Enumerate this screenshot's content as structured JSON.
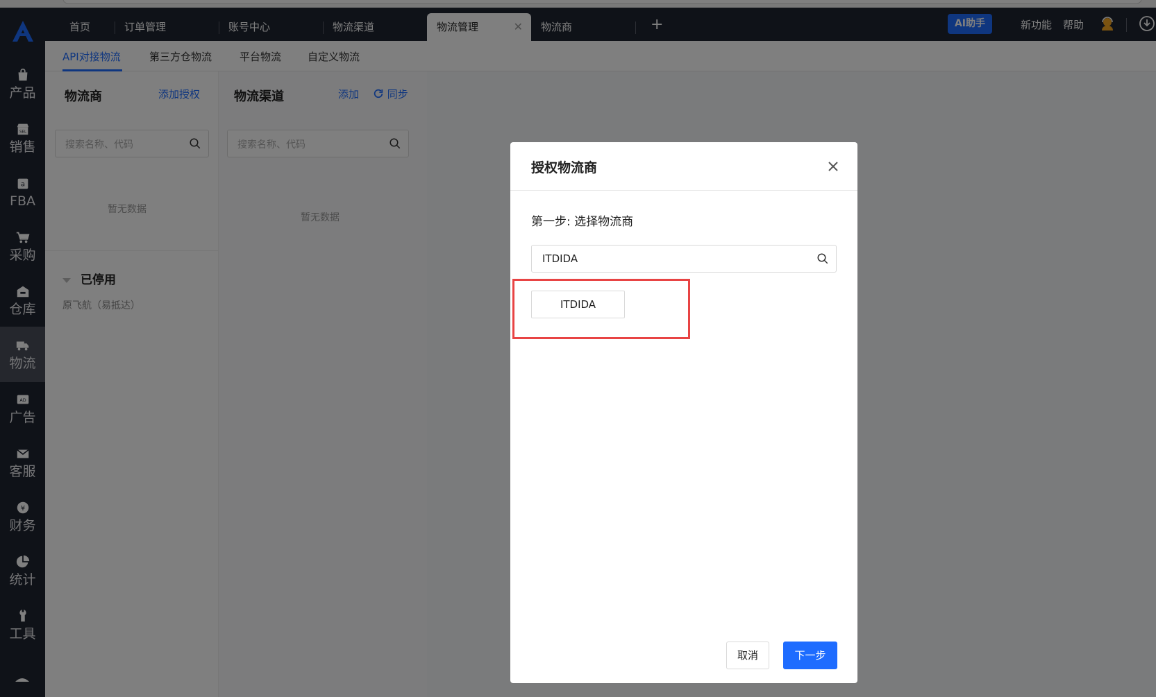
{
  "top_tabs": [
    {
      "label": "首页"
    },
    {
      "label": "订单管理"
    },
    {
      "label": "账号中心"
    },
    {
      "label": "物流渠道"
    },
    {
      "label": "物流管理",
      "active": true
    },
    {
      "label": "物流商"
    }
  ],
  "topbar": {
    "add_tab": "+",
    "ai_label": "AI助手",
    "new_features": "新功能",
    "help": "帮助"
  },
  "sidenav": [
    {
      "label": "产品",
      "icon": "bag-icon"
    },
    {
      "label": "销售",
      "icon": "sell-shop-icon"
    },
    {
      "label": "FBA",
      "icon": "amazon-icon"
    },
    {
      "label": "采购",
      "icon": "cart-icon"
    },
    {
      "label": "仓库",
      "icon": "warehouse-icon"
    },
    {
      "label": "物流",
      "icon": "truck-icon",
      "active": true
    },
    {
      "label": "广告",
      "icon": "ad-icon"
    },
    {
      "label": "客服",
      "icon": "mail-icon"
    },
    {
      "label": "财务",
      "icon": "yen-icon"
    },
    {
      "label": "统计",
      "icon": "pie-chart-icon"
    },
    {
      "label": "工具",
      "icon": "wrench-icon"
    }
  ],
  "subtabs": [
    "API对接物流",
    "第三方仓物流",
    "平台物流",
    "自定义物流"
  ],
  "left_panel": {
    "title": "物流商",
    "action": "添加授权",
    "search_placeholder": "搜索名称、代码",
    "empty": "暂无数据",
    "disabled_title": "已停用",
    "disabled_item": "原飞航（易抵达）"
  },
  "mid_panel": {
    "title": "物流渠道",
    "action_add": "添加",
    "action_sync": "同步",
    "search_placeholder": "搜索名称、代码",
    "empty": "暂无数据"
  },
  "modal": {
    "title": "授权物流商",
    "step": "第一步: 选择物流商",
    "search_value": "ITDIDA",
    "option": "ITDIDA",
    "cancel": "取消",
    "next": "下一步"
  },
  "colors": {
    "accent": "#1e6cff",
    "nav_bg": "#1f2430",
    "highlight": "#e84444"
  }
}
